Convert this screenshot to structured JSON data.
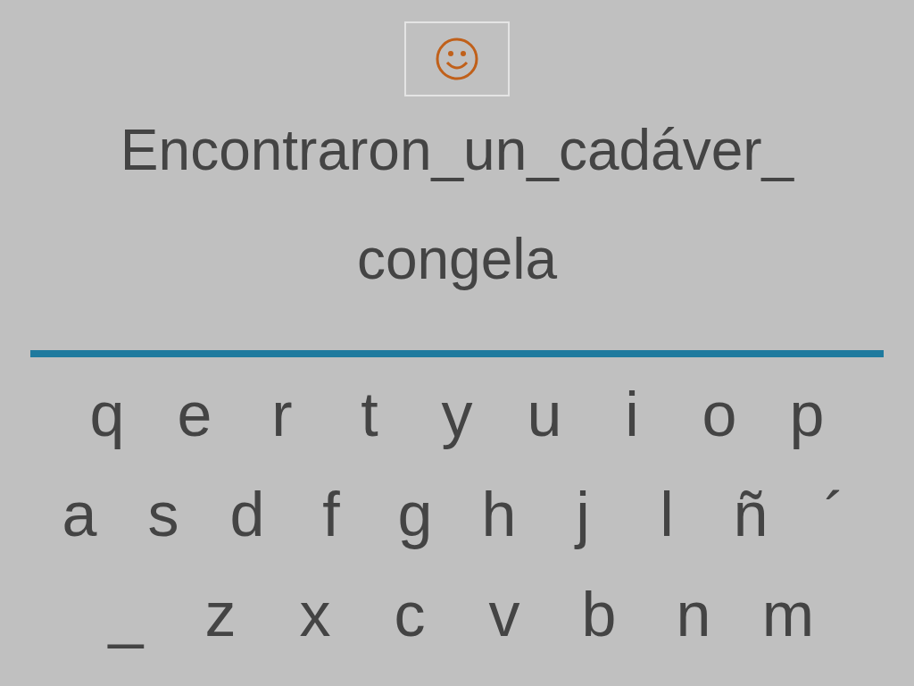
{
  "status": {
    "kind": "smiley"
  },
  "phrase": [
    "Encontraron_un_cadáver_",
    "congela"
  ],
  "keyboard": [
    [
      "q",
      "e",
      "r",
      "t",
      "y",
      "u",
      "i",
      "o",
      "p"
    ],
    [
      "a",
      "s",
      "d",
      "f",
      "g",
      "h",
      "j",
      "l",
      "ñ",
      "´"
    ],
    [
      "_",
      "z",
      "x",
      "c",
      "v",
      "b",
      "n",
      "m"
    ]
  ]
}
